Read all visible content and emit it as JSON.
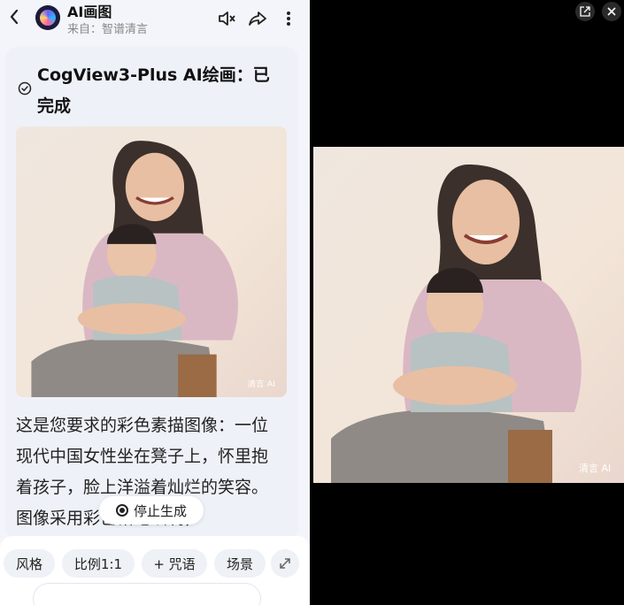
{
  "header": {
    "title": "AI画图",
    "subtitle": "来自：智谱清言",
    "icons": [
      "back-icon",
      "mute-icon",
      "share-icon",
      "more-icon"
    ]
  },
  "card": {
    "title": "CogView3-Plus AI绘画：已完成",
    "status_icon": "check-circle-icon"
  },
  "image": {
    "watermark": "清言 AI"
  },
  "body_text": "这是您要求的彩色素描图像：一位现代中国女性坐在凳子上，怀里抱着孩子，脸上洋溢着灿烂的笑容。图像采用彩色铅笔绘制，",
  "stop_button": {
    "label": "停止生成"
  },
  "chips": [
    {
      "label": "风格"
    },
    {
      "label": "比例1:1"
    },
    {
      "label": "+ 咒语"
    },
    {
      "label": "场景"
    }
  ],
  "viewer": {
    "icons": [
      "open-external-icon",
      "close-icon"
    ]
  },
  "colors": {
    "panel_bg": "#f3f5fa",
    "card_bg": "#eef1f8",
    "viewer_bg": "#000000"
  }
}
